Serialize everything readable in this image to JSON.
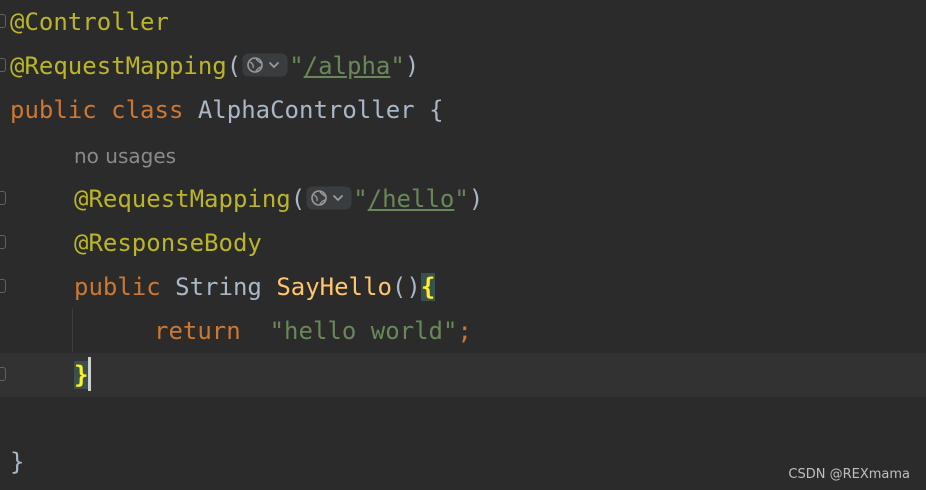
{
  "code": {
    "line1": {
      "annotation": "@Controller"
    },
    "line2": {
      "annotation": "@RequestMapping",
      "open": "(",
      "quote_open": "\"",
      "path": "/alpha",
      "quote_close": "\"",
      "close": ")"
    },
    "line3": {
      "kw_public": "public",
      "kw_class": "class",
      "class_name": "AlphaController",
      "brace": "{"
    },
    "line4": {
      "hint": "no usages"
    },
    "line5": {
      "annotation": "@RequestMapping",
      "open": "(",
      "quote_open": "\"",
      "path": "/hello",
      "quote_close": "\"",
      "close": ")"
    },
    "line6": {
      "annotation": "@ResponseBody"
    },
    "line7": {
      "kw_public": "public",
      "type": "String",
      "method": "SayHello",
      "parens": "()",
      "brace": "{"
    },
    "line8": {
      "kw_return": "return",
      "string": "\"hello world\"",
      "semi": ";"
    },
    "line9": {
      "brace": "}"
    },
    "line11": {
      "brace": "}"
    }
  },
  "icons": {
    "web_chip": "globe-icon",
    "chevron": "chevron-down-icon",
    "gutter": "bookmark-gutter-icon"
  },
  "watermark": "CSDN @REXmama",
  "colors": {
    "background": "#2b2b2b",
    "current_line": "#323232",
    "annotation": "#bbb529",
    "keyword": "#cc7832",
    "method": "#ffc66d",
    "string": "#6a8759",
    "text": "#a9b7c6",
    "brace_match": "#ffef28"
  }
}
